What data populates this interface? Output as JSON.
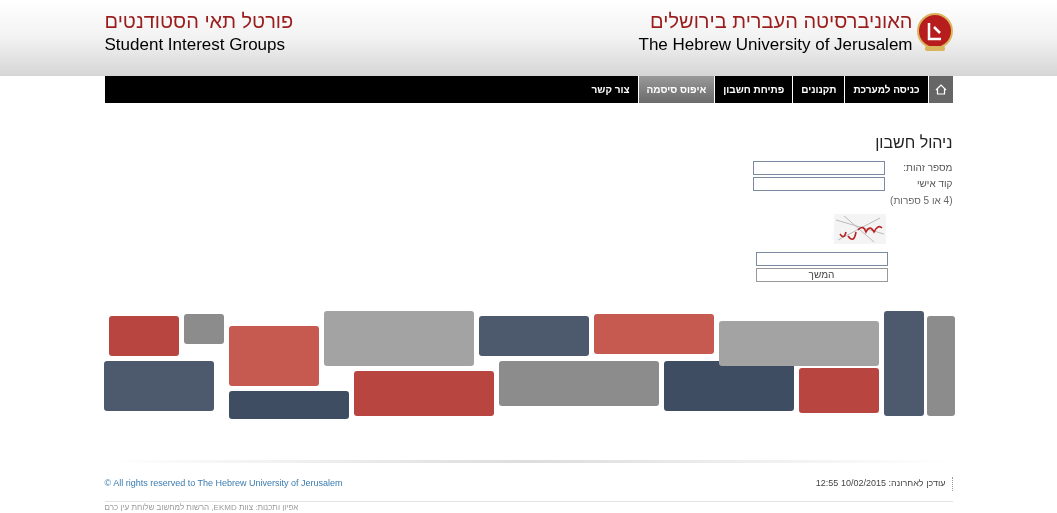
{
  "header": {
    "university_he": "האוניברסיטה העברית בירושלים",
    "university_en": "The Hebrew University of Jerusalem",
    "portal_he": "פורטל תאי הסטודנטים",
    "portal_en": "Student Interest Groups"
  },
  "nav": {
    "items": [
      {
        "label": "כניסה למערכת",
        "selected": false
      },
      {
        "label": "תקנונים",
        "selected": false
      },
      {
        "label": "פתיחת חשבון",
        "selected": false
      },
      {
        "label": "איפוס סיסמה",
        "selected": true
      },
      {
        "label": "צור קשר",
        "selected": false
      }
    ]
  },
  "form": {
    "title": "ניהול חשבון",
    "fields": [
      {
        "label": "מספר זהות:"
      },
      {
        "label": "קוד אישי"
      }
    ],
    "hint": "(4 או 5 ספרות)",
    "submit": "המשך"
  },
  "footer": {
    "copyright": "© All rights reserved to The Hebrew University of Jerusalem",
    "updated": "עודכן לאחרונה: 10/02/2015 12:55",
    "credit": "אפיון ותכנות: צוות EKMD, הרשות למחשוב שלוחת עין כרם"
  }
}
